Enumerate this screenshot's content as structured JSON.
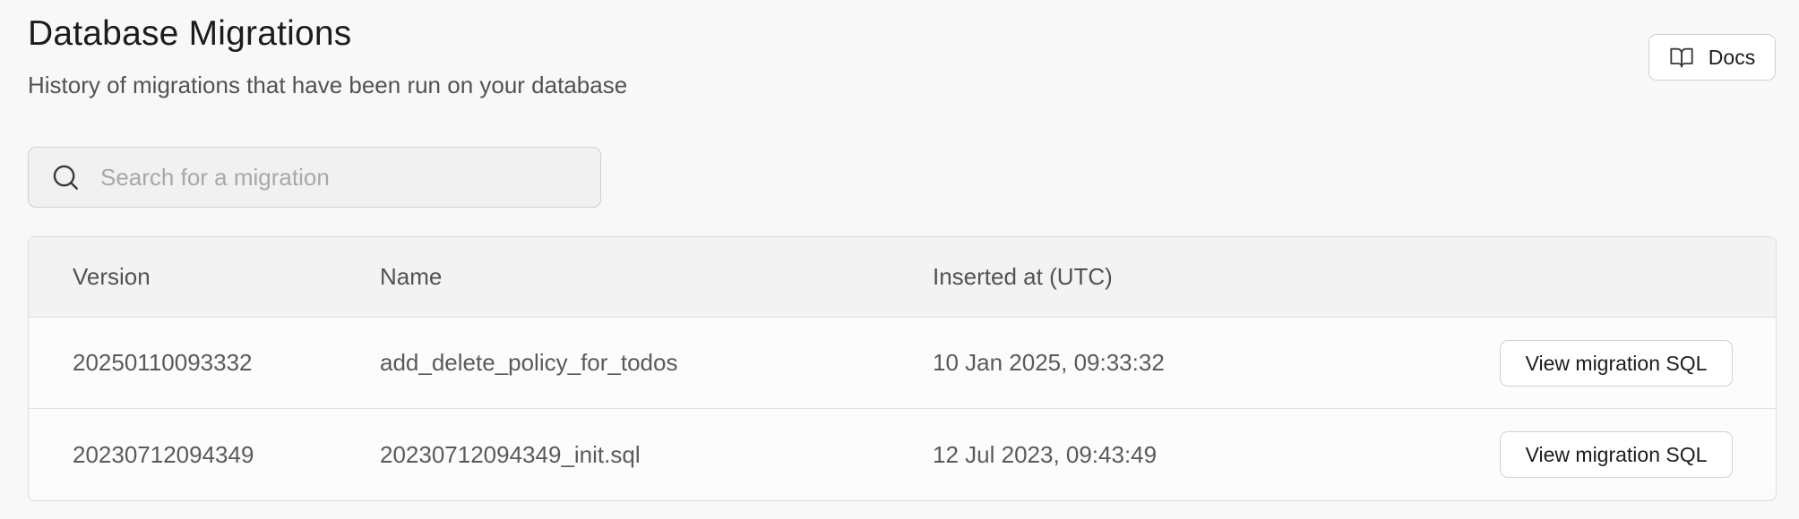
{
  "header": {
    "title": "Database Migrations",
    "subtitle": "History of migrations that have been run on your database",
    "docs_label": "Docs"
  },
  "search": {
    "placeholder": "Search for a migration",
    "value": ""
  },
  "table": {
    "columns": {
      "version": "Version",
      "name": "Name",
      "inserted_at": "Inserted at (UTC)"
    },
    "rows": [
      {
        "version": "20250110093332",
        "name": "add_delete_policy_for_todos",
        "inserted_at": "10 Jan 2025, 09:33:32",
        "action_label": "View migration SQL"
      },
      {
        "version": "20230712094349",
        "name": "20230712094349_init.sql",
        "inserted_at": "12 Jul 2023, 09:43:49",
        "action_label": "View migration SQL"
      }
    ]
  },
  "icons": {
    "docs": "book-open-icon",
    "search": "search-icon"
  }
}
